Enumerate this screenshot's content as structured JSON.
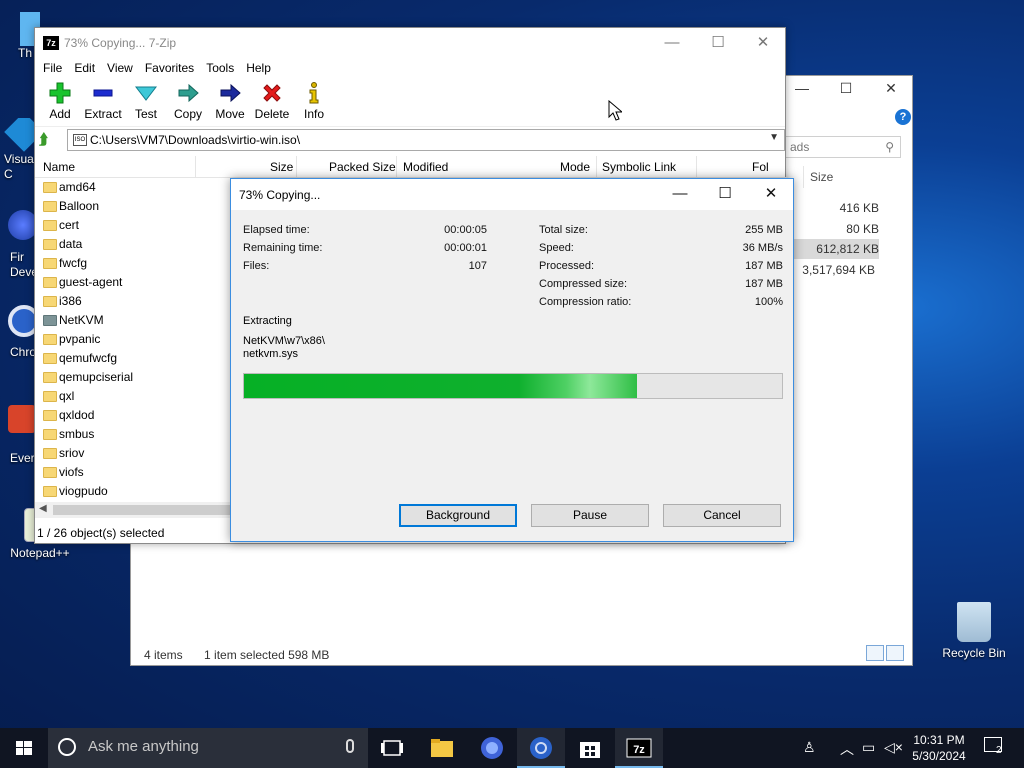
{
  "desktop": {
    "icons": [
      {
        "label": "Th"
      },
      {
        "label": "Visua C"
      },
      {
        "label": "Fir Deve"
      },
      {
        "label": "Chro"
      },
      {
        "label": "Ever"
      },
      {
        "label": "Notepad++"
      },
      {
        "label": "Recycle Bin"
      }
    ]
  },
  "explorer": {
    "search_placeholder": "ads",
    "help": "?",
    "column_size": "Size",
    "sizes": [
      "416 KB",
      "80 KB",
      "612,812 KB",
      "3,517,694 KB"
    ],
    "status_items": "4 items",
    "status_selected": "1 item selected  598 MB"
  },
  "zip": {
    "app_logo": "7z",
    "title": "73% Copying... 7-Zip",
    "menu": [
      "File",
      "Edit",
      "View",
      "Favorites",
      "Tools",
      "Help"
    ],
    "toolbar": [
      "Add",
      "Extract",
      "Test",
      "Copy",
      "Move",
      "Delete",
      "Info"
    ],
    "address": "C:\\Users\\VM7\\Downloads\\virtio-win.iso\\",
    "iso_label": "ISO",
    "columns": [
      "Name",
      "Size",
      "Packed Size",
      "Modified",
      "Mode",
      "Symbolic Link",
      "Fol"
    ],
    "files": [
      "amd64",
      "Balloon",
      "cert",
      "data",
      "fwcfg",
      "guest-agent",
      "i386",
      "NetKVM",
      "pvpanic",
      "qemufwcfg",
      "qemupciserial",
      "qxl",
      "qxldod",
      "smbus",
      "sriov",
      "viofs",
      "viogpudo"
    ],
    "status": "1 / 26 object(s) selected"
  },
  "dialog": {
    "title": "73% Copying...",
    "elapsed_label": "Elapsed time:",
    "elapsed": "00:00:05",
    "remaining_label": "Remaining time:",
    "remaining": "00:00:01",
    "files_label": "Files:",
    "files": "107",
    "total_label": "Total size:",
    "total": "255 MB",
    "speed_label": "Speed:",
    "speed": "36 MB/s",
    "processed_label": "Processed:",
    "processed": "187 MB",
    "compressed_label": "Compressed size:",
    "compressed": "187 MB",
    "ratio_label": "Compression ratio:",
    "ratio": "100%",
    "action": "Extracting",
    "path": "NetKVM\\w7\\x86\\",
    "file": "netkvm.sys",
    "progress_fraction": 0.73,
    "buttons": {
      "background": "Background",
      "pause": "Pause",
      "cancel": "Cancel"
    }
  },
  "taskbar": {
    "search_placeholder": "Ask me anything",
    "time": "10:31 PM",
    "date": "5/30/2024",
    "notifications": "2"
  },
  "colors": {
    "progress": "#06b025",
    "accent": "#0078d7"
  }
}
